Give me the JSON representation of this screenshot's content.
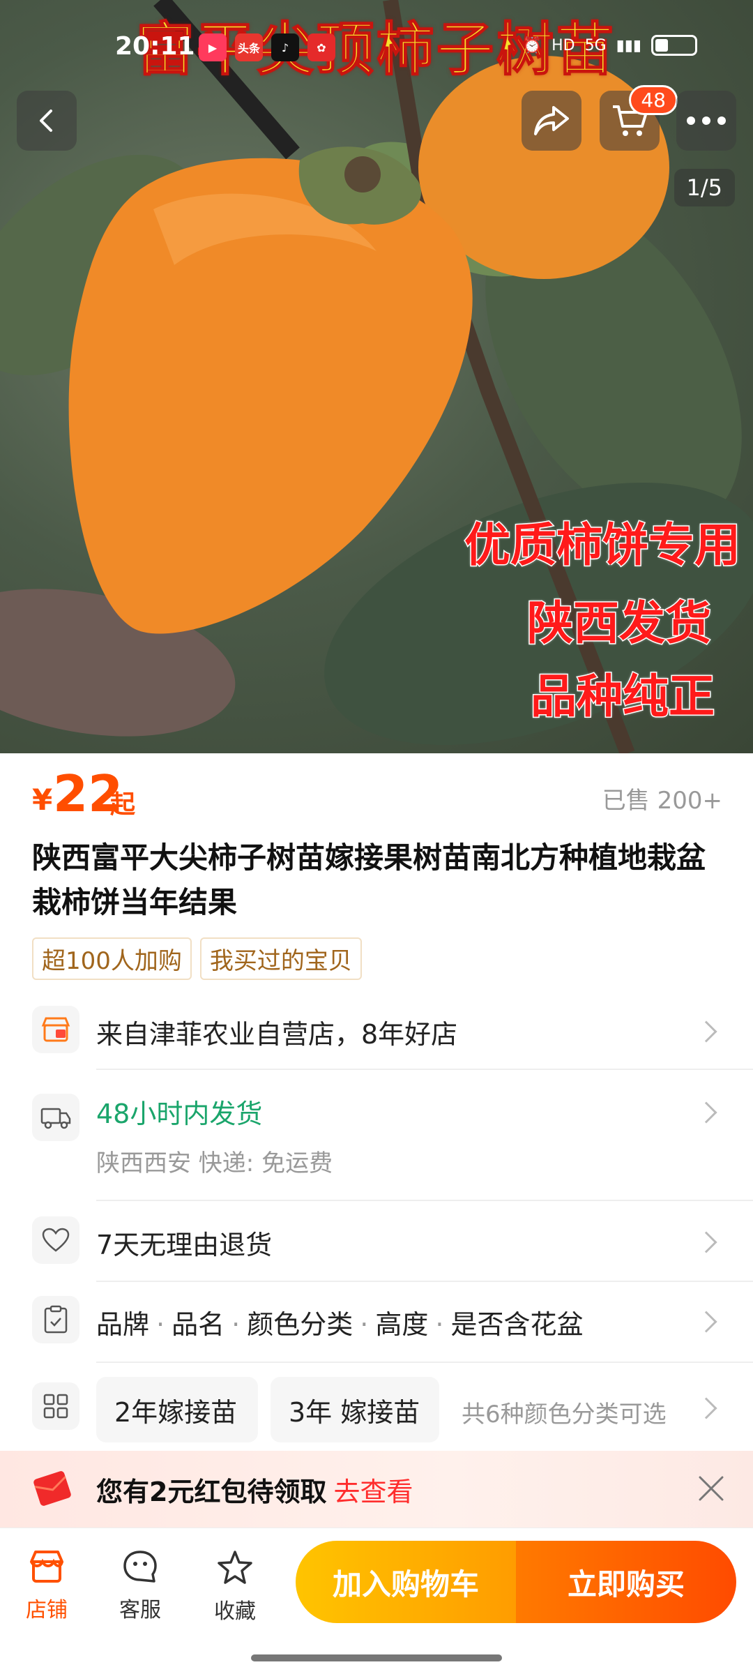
{
  "status_bar": {
    "time": "20:11",
    "apps": [
      {
        "name": "video-app",
        "color": "#ff3a5c",
        "label": "▶"
      },
      {
        "name": "toutiao-app",
        "color": "#e8362f",
        "label": "头条"
      },
      {
        "name": "douyin-app",
        "color": "#111111",
        "label": "♪"
      },
      {
        "name": "red-app",
        "color": "#e52a2a",
        "label": "✿"
      }
    ],
    "hd": "HD",
    "network": "5G"
  },
  "hero": {
    "title": "富平尖顶柿子树苗",
    "promo_lines": [
      "优质柿饼专用",
      "陕西发货",
      "品种纯正"
    ],
    "cart_badge": "48",
    "image_counter": "1/5"
  },
  "product": {
    "price_symbol": "¥",
    "price": "22",
    "price_suffix": "起",
    "sold": "已售 200+",
    "title": "陕西富平大尖柿子树苗嫁接果树苗南北方种植地栽盆栽柿饼当年结果",
    "tags": [
      "超100人加购",
      "我买过的宝贝"
    ]
  },
  "info": {
    "store": "来自津菲农业自营店，8年好店",
    "shipping_main": "48小时内发货",
    "shipping_sub": "陕西西安  快递: 免运费",
    "returns": "7天无理由退货",
    "params": [
      "品牌",
      "品名",
      "颜色分类",
      "高度",
      "是否含花盆"
    ],
    "sku_options": [
      "2年嫁接苗",
      "3年 嫁接苗"
    ],
    "sku_more": "共6种颜色分类可选"
  },
  "coupon": {
    "text": "您有2元红包待领取",
    "link": "去查看"
  },
  "bottom_bar": {
    "store": "店铺",
    "service": "客服",
    "favorite": "收藏",
    "add_to_cart": "加入购物车",
    "buy_now": "立即购买"
  },
  "colors": {
    "price": "#ff4e00",
    "shipping": "#1aa56b",
    "tag_text": "#a0651c",
    "cart_button": "#ffb000",
    "buy_button": "#ff5a00"
  }
}
